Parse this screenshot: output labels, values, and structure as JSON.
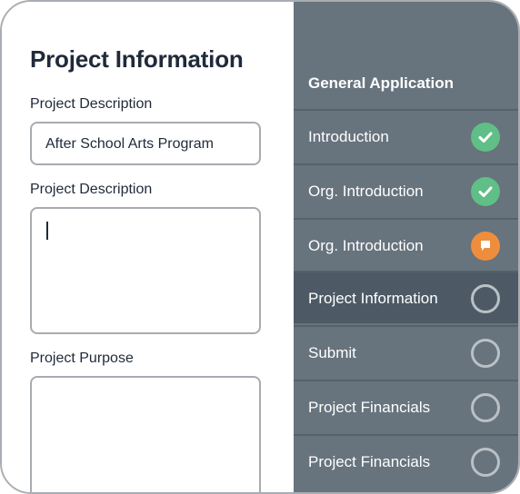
{
  "form": {
    "title": "Project Information",
    "fields": [
      {
        "label": "Project Description",
        "value": "After School Arts Program"
      },
      {
        "label": "Project Description",
        "value": ""
      },
      {
        "label": "Project Purpose",
        "value": ""
      }
    ]
  },
  "sidebar": {
    "header": "General Application",
    "items": [
      {
        "label": "Introduction",
        "status": "check-icon"
      },
      {
        "label": "Org. Introduction",
        "status": "check-icon"
      },
      {
        "label": "Org. Introduction",
        "status": "flag-icon"
      },
      {
        "label": "Project Information",
        "status": "empty-circle-icon"
      },
      {
        "label": "Submit",
        "status": "empty-circle-icon"
      },
      {
        "label": "Project Financials",
        "status": "empty-circle-icon"
      },
      {
        "label": "Project Financials",
        "status": "empty-circle-icon"
      }
    ]
  },
  "colors": {
    "sidebar_bg": "#67737d",
    "sidebar_active": "#4d5a65",
    "complete": "#5fbf86",
    "flagged": "#ee8e3c",
    "title": "#1f2a3a"
  }
}
